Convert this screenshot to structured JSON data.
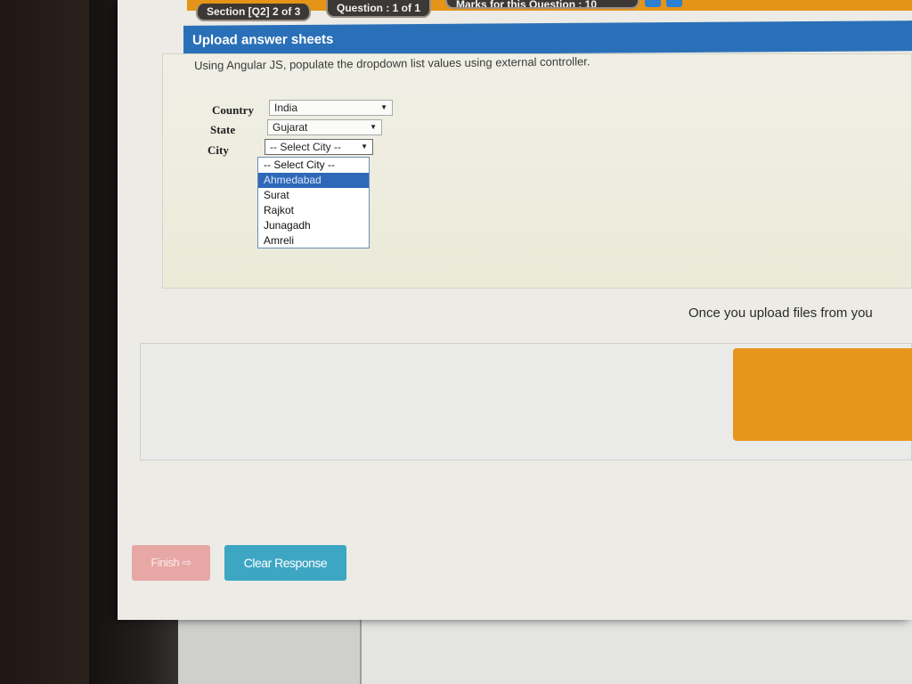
{
  "header": {
    "section_pill": "Section [Q2] 2 of 3",
    "question_pill": "Question : 1 of 1",
    "marks_pill": "Marks for this Question : 10"
  },
  "panel": {
    "title": "Upload answer sheets",
    "question": "Using Angular JS, populate the dropdown list values using external controller."
  },
  "form": {
    "country_label": "Country",
    "country_value": "India",
    "state_label": "State",
    "state_value": "Gujarat",
    "city_label": "City",
    "city_value": "-- Select City --",
    "city_options": [
      "-- Select City --",
      "Ahmedabad",
      "Surat",
      "Rajkot",
      "Junagadh",
      "Amreli"
    ],
    "city_highlighted": "Ahmedabad"
  },
  "upload": {
    "note": "Once you upload files from you"
  },
  "buttons": {
    "finish": "Finish ⇨",
    "clear_response": "Clear Response"
  },
  "colors": {
    "accent_orange": "#e59417",
    "title_blue": "#2a70b8",
    "clear_button": "#3ca6c3",
    "finish_button": "#e7a7a4",
    "highlight_blue": "#2f68b9"
  }
}
